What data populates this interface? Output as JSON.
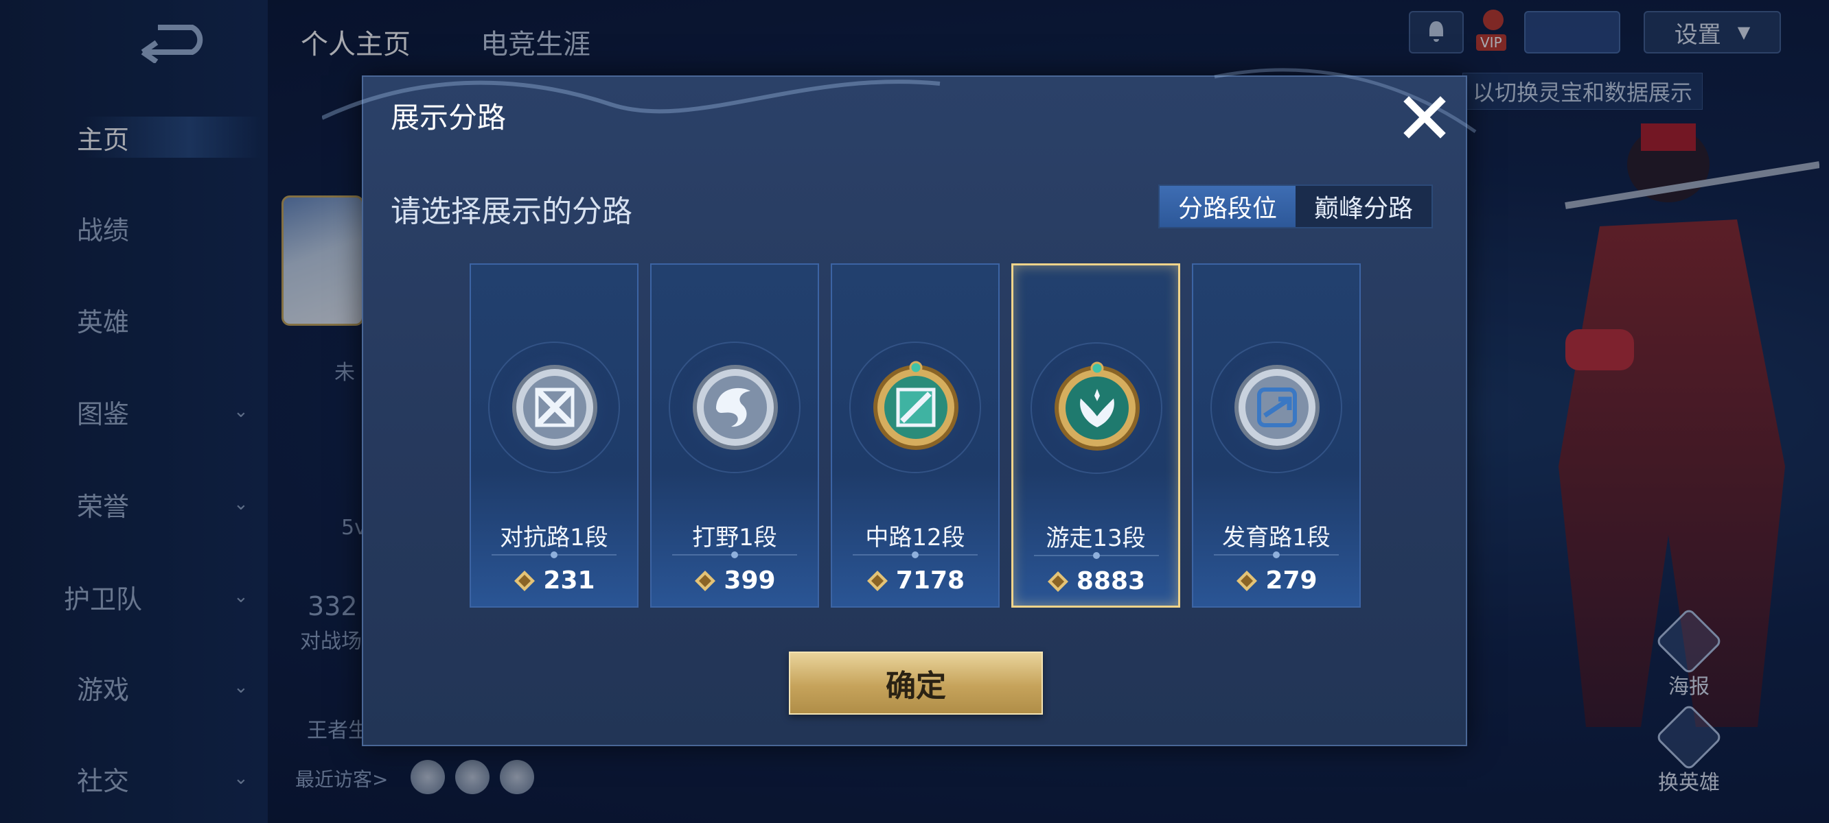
{
  "background": {
    "top_tabs": [
      "个人主页",
      "电竞生涯"
    ],
    "sidebar": [
      {
        "label": "主页",
        "chevron": false,
        "active": true
      },
      {
        "label": "战绩",
        "chevron": false
      },
      {
        "label": "英雄",
        "chevron": false
      },
      {
        "label": "图鉴",
        "chevron": true
      },
      {
        "label": "荣誉",
        "chevron": true
      },
      {
        "label": "护卫队",
        "chevron": true
      },
      {
        "label": "游戏",
        "chevron": true
      },
      {
        "label": "社交",
        "chevron": true
      }
    ],
    "settings_label": "设置",
    "vip_label": "VIP",
    "hint_text": "以切换灵宝和数据展示",
    "poster_label": "海报",
    "switch_hero_label": "换英雄",
    "recent_visitors_label": "最近访客>",
    "fragments": [
      "5v",
      "332",
      "对战场",
      "王者生",
      "未"
    ]
  },
  "modal": {
    "title": "展示分路",
    "subtitle": "请选择展示的分路",
    "tabs": [
      {
        "label": "分路段位",
        "active": true
      },
      {
        "label": "巅峰分路",
        "active": false
      }
    ],
    "lanes": [
      {
        "label": "对抗路1段",
        "score": "231",
        "selected": false,
        "tier": "silver",
        "icon": "crossed-swords-icon"
      },
      {
        "label": "打野1段",
        "score": "399",
        "selected": false,
        "tier": "silver",
        "icon": "dragon-icon"
      },
      {
        "label": "中路12段",
        "score": "7178",
        "selected": false,
        "tier": "gold",
        "icon": "wand-icon"
      },
      {
        "label": "游走13段",
        "score": "8883",
        "selected": true,
        "tier": "gold",
        "icon": "wings-icon"
      },
      {
        "label": "发育路1段",
        "score": "279",
        "selected": false,
        "tier": "silver",
        "icon": "arrow-target-icon"
      }
    ],
    "confirm_label": "确定"
  },
  "colors": {
    "gold_accent": "#f0d48a",
    "active_tab": "#3e6db3",
    "modal_bg": "#2b4168"
  }
}
